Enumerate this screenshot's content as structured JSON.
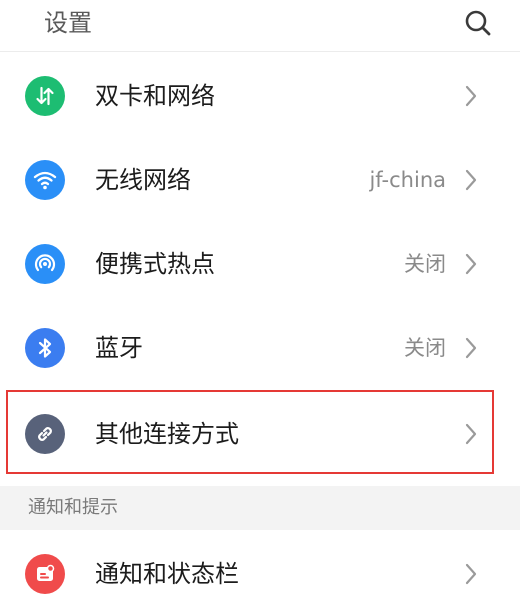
{
  "header": {
    "title": "设置",
    "search_icon": "search-icon"
  },
  "items": [
    {
      "label": "双卡和网络",
      "value": "",
      "icon": "dual-sim-network-icon",
      "color": "#1dbd72"
    },
    {
      "label": "无线网络",
      "value": "jf-china",
      "icon": "wifi-icon",
      "color": "#2a8ff7"
    },
    {
      "label": "便携式热点",
      "value": "关闭",
      "icon": "hotspot-icon",
      "color": "#2a8ff7"
    },
    {
      "label": "蓝牙",
      "value": "关闭",
      "icon": "bluetooth-icon",
      "color": "#3b7df0"
    },
    {
      "label": "其他连接方式",
      "value": "",
      "icon": "link-icon",
      "color": "#58627a"
    }
  ],
  "section": {
    "title": "通知和提示"
  },
  "notification_item": {
    "label": "通知和状态栏",
    "value": "",
    "icon": "notification-icon",
    "color": "#f04b4b"
  },
  "colors": {
    "highlight": "#e53935",
    "chevron": "#9a9a9a"
  }
}
